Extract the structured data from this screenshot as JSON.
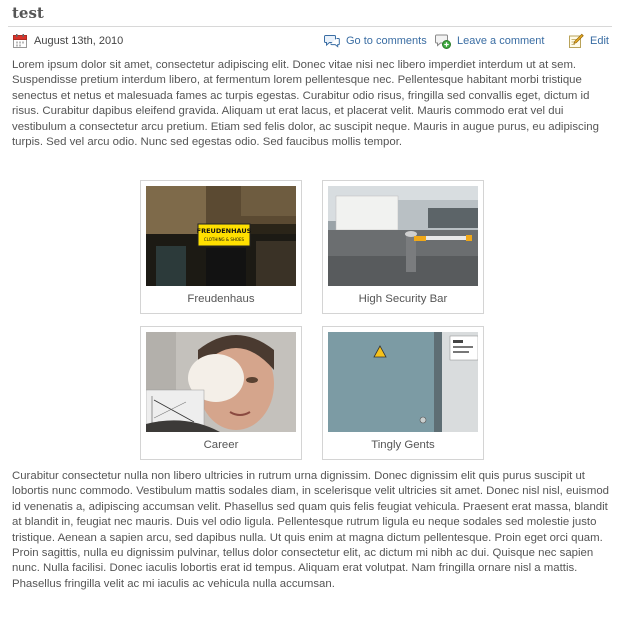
{
  "post": {
    "title": "test",
    "date": "August 13th, 2010",
    "actions": {
      "comments": "Go to comments",
      "leave_comment": "Leave a comment",
      "edit": "Edit"
    },
    "paragraph_1": "Lorem ipsum dolor sit amet, consectetur adipiscing elit. Donec vitae nisi nec libero imperdiet interdum ut at sem. Suspendisse pretium interdum libero, at fermentum lorem pellentesque nec. Pellentesque habitant morbi tristique senectus et netus et malesuada fames ac turpis egestas. Curabitur odio risus, fringilla sed convallis eget, dictum id risus. Curabitur dapibus eleifend gravida. Aliquam ut erat lacus, et placerat velit. Mauris commodo erat vel dui vestibulum a consectetur arcu pretium. Etiam sed felis dolor, ac suscipit neque. Mauris in augue purus, eu adipiscing turpis. Sed vel arcu odio. Nunc sed egestas odio. Sed faucibus mollis tempor.",
    "gallery": [
      {
        "caption": "Freudenhaus",
        "sign_text": "FREUDENHAUS",
        "sign_sub": "CLOTHING & SHOES"
      },
      {
        "caption": "High Security Bar"
      },
      {
        "caption": "Career"
      },
      {
        "caption": "Tingly Gents"
      }
    ],
    "paragraph_2": "Curabitur consectetur nulla non libero ultricies in rutrum urna dignissim. Donec dignissim elit quis purus suscipit ut lobortis nunc commodo. Vestibulum mattis sodales diam, in scelerisque velit ultricies sit amet. Donec nisl nisl, euismod id venenatis a, adipiscing accumsan velit. Phasellus sed quam quis felis feugiat vehicula. Praesent erat massa, blandit at blandit in, feugiat nec mauris. Duis vel odio ligula. Pellentesque rutrum ligula eu neque sodales sed molestie justo tristique. Aenean a sapien arcu, sed dapibus nulla. Ut quis enim at magna dictum pellentesque. Proin eget orci quam. Proin sagittis, nulla eu dignissim pulvinar, tellus dolor consectetur elit, ac dictum mi nibh ac dui. Quisque nec sapien nunc. Nulla facilisi. Donec iaculis lobortis erat id tempus. Aliquam erat volutpat. Nam fringilla ornare nisl a mattis. Phasellus fringilla velit ac mi iaculis ac vehicula nulla accumsan."
  },
  "colors": {
    "link": "#3a6da3",
    "text": "#555555",
    "border": "#d4d4d4"
  }
}
